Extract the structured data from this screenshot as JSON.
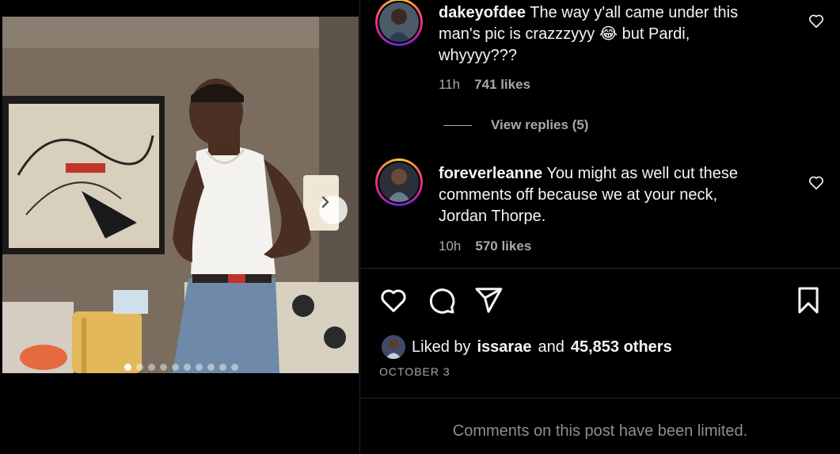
{
  "post": {
    "image_alt": "Smiling man in white tank top and jeans in a hotel room",
    "carousel": {
      "total": 10,
      "active_index": 0
    }
  },
  "comments": [
    {
      "username": "dakeyofdee",
      "text": "The way y'all came under this man's pic is crazzzyyy 😂 but Pardi, whyyyy???",
      "time": "11h",
      "likes": "741 likes"
    },
    {
      "username": "foreverleanne",
      "text": "You might as well cut these comments off because we at your neck, Jordan Thorpe.",
      "time": "10h",
      "likes": "570 likes"
    }
  ],
  "view_replies": "View replies (5)",
  "liked_by": {
    "prefix": "Liked by",
    "user": "issarae",
    "conj": "and",
    "others": "45,853 others"
  },
  "date": "OCTOBER 3",
  "limited_notice": "Comments on this post have been limited.",
  "icons": [
    "heart-icon",
    "comment-icon",
    "share-icon",
    "bookmark-icon",
    "chevron-right-icon"
  ]
}
